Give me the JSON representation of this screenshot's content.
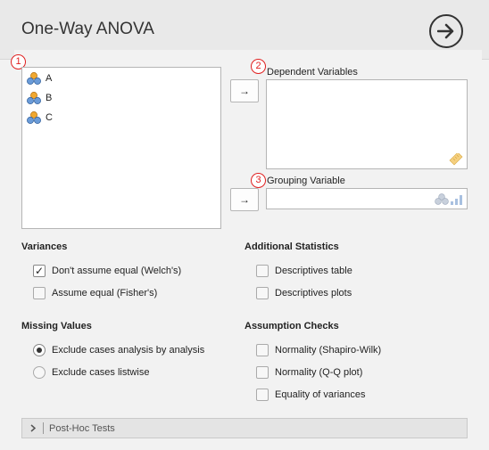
{
  "header": {
    "title": "One-Way ANOVA",
    "run_icon": "arrow-right-circle-icon"
  },
  "markers": [
    "1",
    "2",
    "3"
  ],
  "source_variables": [
    {
      "label": "A",
      "icon": "nominal-variable-icon"
    },
    {
      "label": "B",
      "icon": "nominal-variable-icon"
    },
    {
      "label": "C",
      "icon": "nominal-variable-icon"
    }
  ],
  "targets": {
    "move_label": "→",
    "dependent_label": "Dependent Variables",
    "grouping_label": "Grouping Variable"
  },
  "variances": {
    "title": "Variances",
    "options": [
      {
        "label": "Don't assume equal (Welch's)",
        "checked": true
      },
      {
        "label": "Assume equal (Fisher's)",
        "checked": false
      }
    ]
  },
  "additional_statistics": {
    "title": "Additional Statistics",
    "options": [
      {
        "label": "Descriptives table",
        "checked": false
      },
      {
        "label": "Descriptives plots",
        "checked": false
      }
    ]
  },
  "missing_values": {
    "title": "Missing Values",
    "options": [
      {
        "label": "Exclude cases analysis by analysis",
        "selected": true
      },
      {
        "label": "Exclude cases listwise",
        "selected": false
      }
    ]
  },
  "assumption_checks": {
    "title": "Assumption Checks",
    "options": [
      {
        "label": "Normality (Shapiro-Wilk)",
        "checked": false
      },
      {
        "label": "Normality (Q-Q plot)",
        "checked": false
      },
      {
        "label": "Equality of variances",
        "checked": false
      }
    ]
  },
  "post_hoc": {
    "label": "Post-Hoc Tests",
    "expanded": false
  },
  "colors": {
    "marker_red": "#e02020",
    "icon_orange": "#f0a830",
    "icon_blue": "#6a9bd8",
    "ruler_yellow": "#f5d080"
  }
}
